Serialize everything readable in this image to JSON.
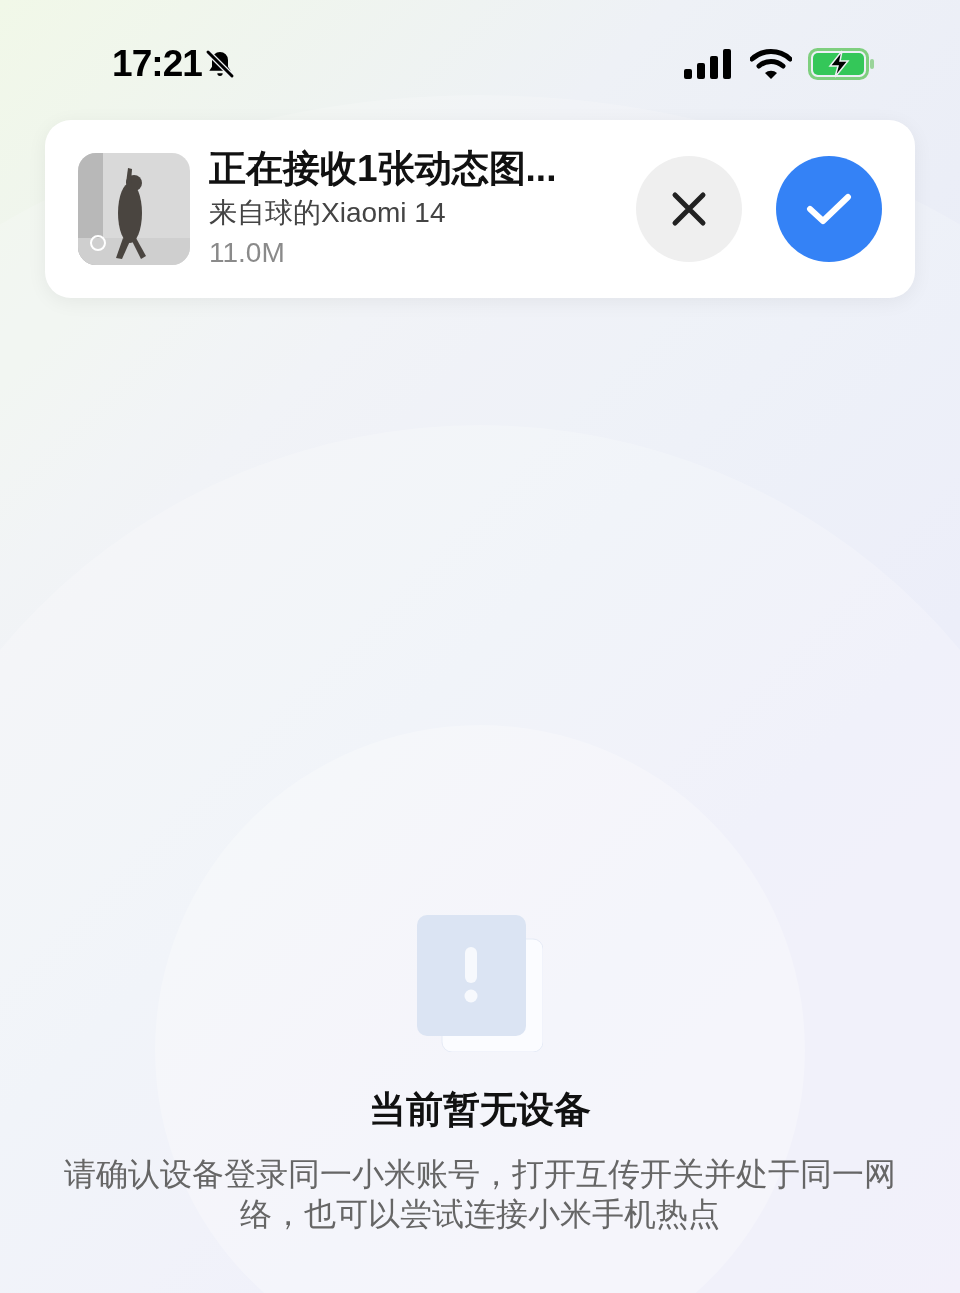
{
  "status_bar": {
    "time": "17:21"
  },
  "notification": {
    "title": "正在接收1张动态图...",
    "sender": "来自球的Xiaomi 14",
    "size": "11.0M"
  },
  "empty_state": {
    "title": "当前暂无设备",
    "description": "请确认设备登录同一小米账号，打开互传开关并处于同一网络，也可以尝试连接小米手机热点"
  }
}
